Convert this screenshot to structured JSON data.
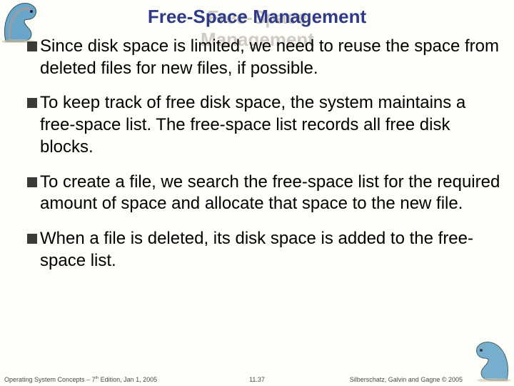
{
  "title": "Free-Space Management",
  "bullets": [
    "Since disk space is limited, we need to reuse the space from deleted files for new files, if possible.",
    "To keep track of free disk space, the system maintains a free-space list. The free-space list records all free disk blocks.",
    "To create a file, we search the free-space list for the required amount of space and allocate that space to the new file.",
    "When a file is deleted, its disk space is added to the free-space list."
  ],
  "footer": {
    "left_pre": "Operating System Concepts – 7",
    "left_sup": "th",
    "left_post": " Edition, Jan 1, 2005",
    "center": "11.37",
    "right": "Silberschatz, Galvin and Gagne © 2005"
  }
}
